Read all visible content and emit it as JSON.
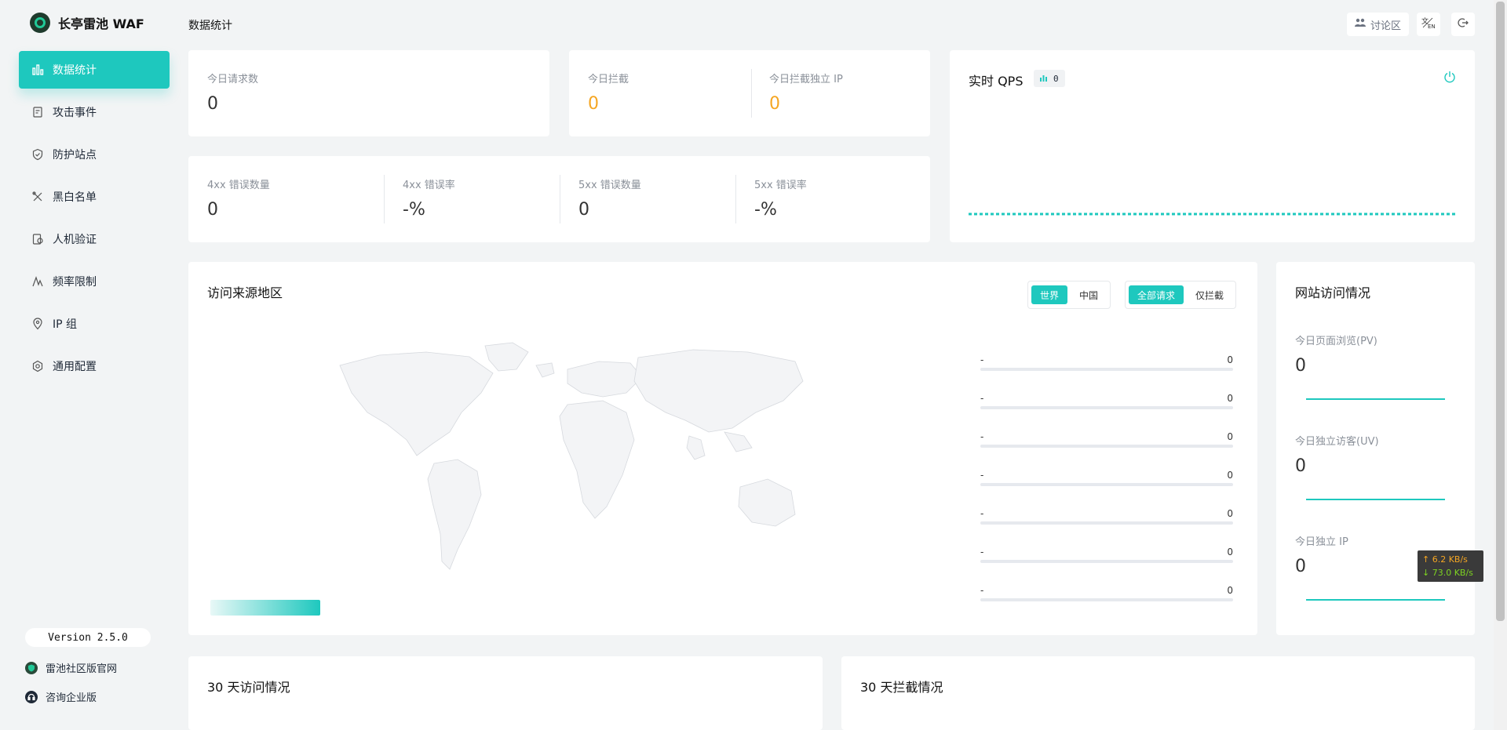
{
  "brand": {
    "name": "长亭雷池 WAF"
  },
  "sidebar": {
    "items": [
      {
        "label": "数据统计",
        "icon": "bar-chart-icon",
        "active": true
      },
      {
        "label": "攻击事件",
        "icon": "document-icon",
        "active": false
      },
      {
        "label": "防护站点",
        "icon": "shield-icon",
        "active": false
      },
      {
        "label": "黑白名单",
        "icon": "tools-icon",
        "active": false
      },
      {
        "label": "人机验证",
        "icon": "captcha-icon",
        "active": false
      },
      {
        "label": "频率限制",
        "icon": "pulse-icon",
        "active": false
      },
      {
        "label": "IP 组",
        "icon": "location-pin-icon",
        "active": false
      },
      {
        "label": "通用配置",
        "icon": "gear-icon",
        "active": false
      }
    ],
    "version": "Version 2.5.0",
    "links": [
      {
        "label": "雷池社区版官网",
        "icon": "shield-logo-icon"
      },
      {
        "label": "咨询企业版",
        "icon": "headset-icon"
      }
    ]
  },
  "header": {
    "title": "数据统计",
    "forum_label": "讨论区",
    "lang_icon": "language-switch-icon",
    "logout_icon": "logout-icon"
  },
  "today_requests": {
    "label": "今日请求数",
    "value": "0"
  },
  "today_blocks": {
    "blocked_label": "今日拦截",
    "blocked_value": "0",
    "ip_label": "今日拦截独立 IP",
    "ip_value": "0"
  },
  "errors": [
    {
      "label": "4xx 错误数量",
      "value": "0"
    },
    {
      "label": "4xx 错误率",
      "value": "-%"
    },
    {
      "label": "5xx 错误数量",
      "value": "0"
    },
    {
      "label": "5xx 错误率",
      "value": "-%"
    }
  ],
  "qps": {
    "title": "实时 QPS",
    "badge_value": "0",
    "accent": "#1ec8be"
  },
  "geo": {
    "title": "访问来源地区",
    "scope_options": [
      "世界",
      "中国"
    ],
    "scope_selected": "世界",
    "filter_options": [
      "全部请求",
      "仅拦截"
    ],
    "filter_selected": "全部请求",
    "ranking": [
      {
        "name": "-",
        "value": "0"
      },
      {
        "name": "-",
        "value": "0"
      },
      {
        "name": "-",
        "value": "0"
      },
      {
        "name": "-",
        "value": "0"
      },
      {
        "name": "-",
        "value": "0"
      },
      {
        "name": "-",
        "value": "0"
      },
      {
        "name": "-",
        "value": "0"
      }
    ]
  },
  "site_visits": {
    "title": "网站访问情况",
    "pv_label": "今日页面浏览(PV)",
    "pv_value": "0",
    "uv_label": "今日独立访客(UV)",
    "uv_value": "0",
    "ip_label": "今日独立 IP",
    "ip_value": "0"
  },
  "network_overlay": {
    "up": "↑ 6.2 KB/s",
    "down": "↓ 73.0 KB/s"
  },
  "visits_30d": {
    "title": "30 天访问情况"
  },
  "blocks_30d": {
    "title": "30 天拦截情况"
  },
  "colors": {
    "accent": "#1ec8be",
    "warning": "#f5a623",
    "background": "#f2f4f5"
  }
}
